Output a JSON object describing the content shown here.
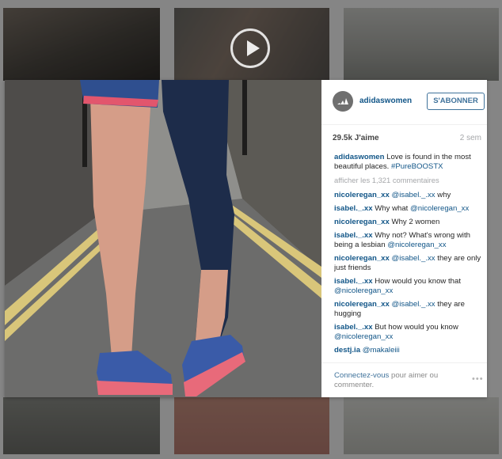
{
  "post": {
    "username": "adidaswomen",
    "follow_label": "S'ABONNER",
    "likes": "29.5k J'aime",
    "age": "2 sem",
    "caption": {
      "user": "adidaswomen",
      "text": " Love is found in the most beautiful places. ",
      "hashtag": "#PureBOOSTX"
    },
    "more_comments": "afficher les 1,321 commentaires",
    "comments": [
      {
        "user": "nicoleregan_xx",
        "parts": [
          {
            "t": " ",
            "m": false
          },
          {
            "t": "@isabel._.xx",
            "m": true
          },
          {
            "t": " why",
            "m": false
          }
        ]
      },
      {
        "user": "isabel._.xx",
        "parts": [
          {
            "t": " Why what ",
            "m": false
          },
          {
            "t": "@nicoleregan_xx",
            "m": true
          }
        ]
      },
      {
        "user": "nicoleregan_xx",
        "parts": [
          {
            "t": " Why 2 women",
            "m": false
          }
        ]
      },
      {
        "user": "isabel._.xx",
        "parts": [
          {
            "t": " Why not? What's wrong with being a lesbian ",
            "m": false
          },
          {
            "t": "@nicoleregan_xx",
            "m": true
          }
        ]
      },
      {
        "user": "nicoleregan_xx",
        "parts": [
          {
            "t": " ",
            "m": false
          },
          {
            "t": "@isabel._.xx",
            "m": true
          },
          {
            "t": " they are only just friends",
            "m": false
          }
        ]
      },
      {
        "user": "isabel._.xx",
        "parts": [
          {
            "t": " How would you know that ",
            "m": false
          },
          {
            "t": "@nicoleregan_xx",
            "m": true
          }
        ]
      },
      {
        "user": "nicoleregan_xx",
        "parts": [
          {
            "t": " ",
            "m": false
          },
          {
            "t": "@isabel._.xx",
            "m": true
          },
          {
            "t": " they are hugging",
            "m": false
          }
        ]
      },
      {
        "user": "isabel._.xx",
        "parts": [
          {
            "t": " But how would you know ",
            "m": false
          },
          {
            "t": "@nicoleregan_xx",
            "m": true
          }
        ]
      },
      {
        "user": "destj.ia",
        "parts": [
          {
            "t": " ",
            "m": false
          },
          {
            "t": "@makaleiii",
            "m": true
          }
        ]
      }
    ],
    "footer": {
      "link": "Connectez-vous",
      "text": " pour aimer ou commenter."
    },
    "options_icon": "more-dots-icon"
  },
  "colors": {
    "link": "#125688",
    "follow": "#3f729b",
    "muted": "#a5a7aa"
  }
}
